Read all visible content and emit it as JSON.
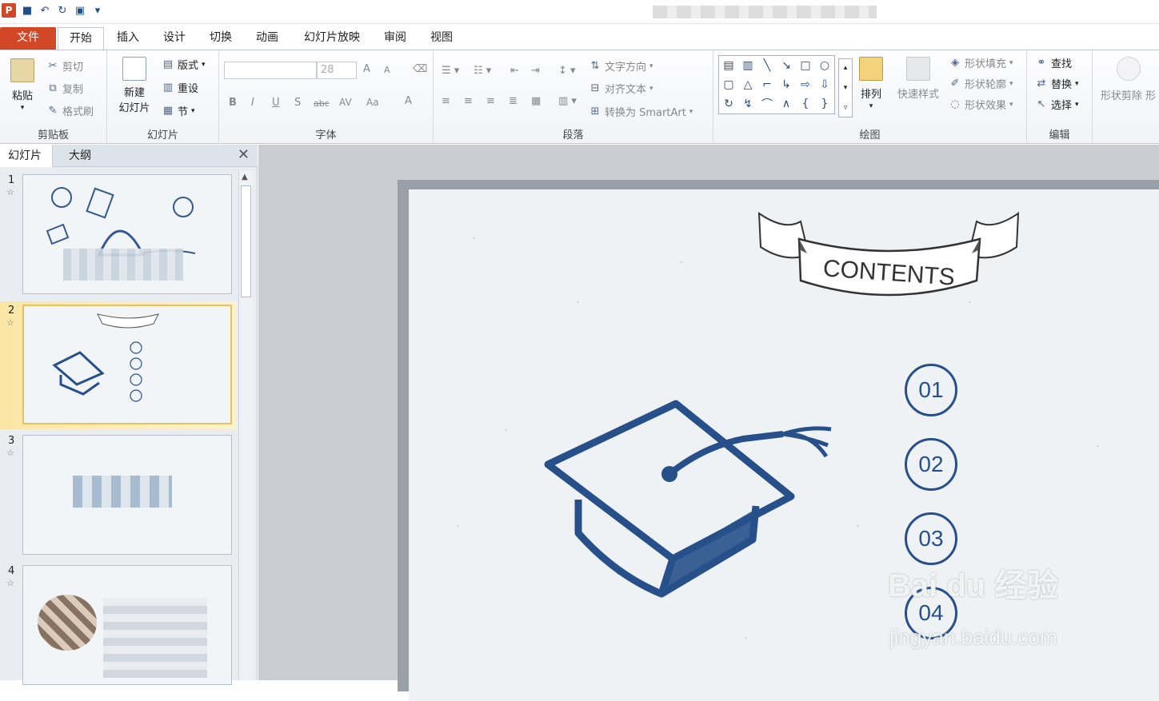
{
  "app": {
    "logo": "P"
  },
  "tabs": [
    "文件",
    "开始",
    "插入",
    "设计",
    "切换",
    "动画",
    "幻灯片放映",
    "审阅",
    "视图"
  ],
  "clipboard": {
    "paste": "粘贴",
    "cut": "剪切",
    "copy": "复制",
    "format_painter": "格式刷",
    "label": "剪贴板"
  },
  "slides_group": {
    "new_slide_1": "新建",
    "new_slide_2": "幻灯片",
    "layout": "版式",
    "reset": "重设",
    "section": "节",
    "label": "幻灯片"
  },
  "font": {
    "size": "28",
    "label": "字体",
    "bold": "B",
    "italic": "I",
    "underline": "U",
    "shadow": "S",
    "strike": "abc",
    "spacing": "AV",
    "case": "Aa",
    "color": "A",
    "grow": "A",
    "shrink": "A"
  },
  "paragraph": {
    "text_direction": "文字方向",
    "align_text": "对齐文本",
    "smartart": "转换为 SmartArt",
    "label": "段落"
  },
  "drawing": {
    "arrange": "排列",
    "quick_styles": "快速样式",
    "fill": "形状填充",
    "outline": "形状轮廓",
    "effects": "形状效果",
    "label": "绘图"
  },
  "editing": {
    "find": "查找",
    "replace": "替换",
    "select": "选择",
    "label": "编辑"
  },
  "shape_erase": "形状剪除 形",
  "pane": {
    "tab_slides": "幻灯片",
    "tab_outline": "大纲",
    "close": "✕"
  },
  "thumbs": [
    {
      "num": "1"
    },
    {
      "num": "2"
    },
    {
      "num": "3"
    },
    {
      "num": "4"
    }
  ],
  "slide": {
    "banner": "CONTENTS",
    "items": [
      "01",
      "02",
      "03",
      "04"
    ]
  },
  "watermark": {
    "line1": "Bai du 经验",
    "line2": "jingyan.baidu.com"
  },
  "colors": {
    "accent": "#27508a",
    "file_tab": "#d24726",
    "selected_thumb": "#e6c35c"
  }
}
